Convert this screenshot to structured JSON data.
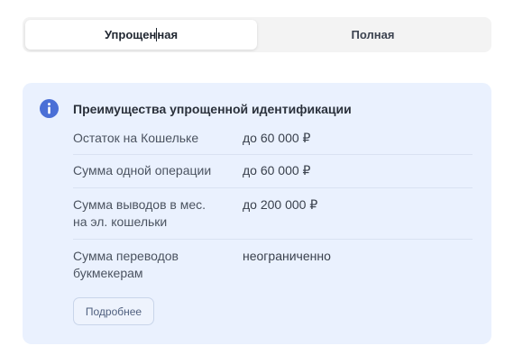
{
  "tabs": [
    {
      "label_start": "Упрощен",
      "label_end": "ная",
      "active": true
    },
    {
      "label": "Полная",
      "active": false
    }
  ],
  "info_card": {
    "icon": "info-icon",
    "title": "Преимущества упрощенной идентификации",
    "rows": [
      {
        "label": "Остаток на Кошельке",
        "value": "до 60 000 ₽"
      },
      {
        "label": "Сумма одной операции",
        "value": "до 60 000 ₽"
      },
      {
        "label_line1": "Сумма выводов в мес.",
        "label_line2": "на эл. кошельки",
        "value": "до 200 000 ₽"
      },
      {
        "label_line1": "Сумма переводов",
        "label_line2": "букмекерам",
        "value": "неограниченно"
      }
    ],
    "more_button": "Подробнее"
  },
  "colors": {
    "accent": "#4a6fd6",
    "card_bg": "#eaf1fe",
    "tabs_bg": "#f3f3f3"
  }
}
